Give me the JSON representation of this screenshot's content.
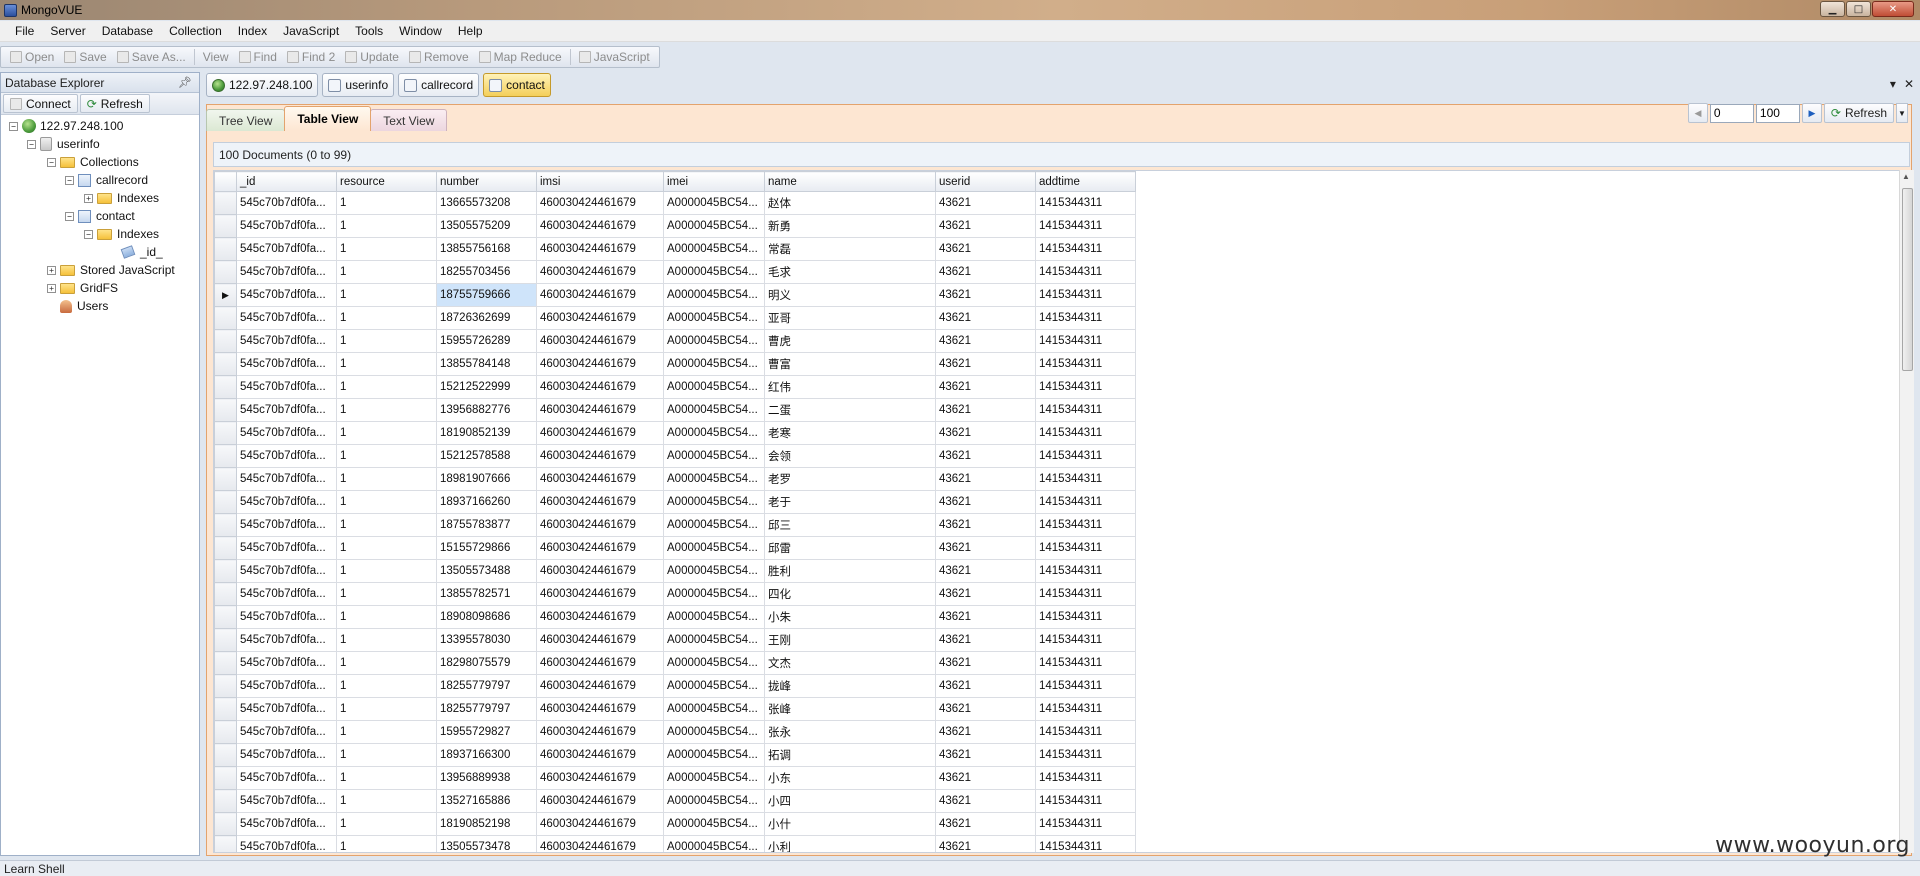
{
  "window": {
    "title": "MongoVUE"
  },
  "menu": [
    "File",
    "Server",
    "Database",
    "Collection",
    "Index",
    "JavaScript",
    "Tools",
    "Window",
    "Help"
  ],
  "toolbar": [
    {
      "label": "Open",
      "icon": "open-icon"
    },
    {
      "label": "Save",
      "icon": "save-icon"
    },
    {
      "label": "Save As...",
      "icon": "save-as-icon"
    },
    {
      "label": "View",
      "icon": ""
    },
    {
      "label": "Find",
      "icon": "find-icon"
    },
    {
      "label": "Find 2",
      "icon": "find2-icon"
    },
    {
      "label": "Update",
      "icon": "update-icon"
    },
    {
      "label": "Remove",
      "icon": "remove-icon"
    },
    {
      "label": "Map Reduce",
      "icon": "map-reduce-icon"
    },
    {
      "label": "JavaScript",
      "icon": "javascript-icon"
    }
  ],
  "explorer": {
    "title": "Database Explorer",
    "connect_label": "Connect",
    "refresh_label": "Refresh",
    "tree": {
      "server": "122.97.248.100",
      "database": "userinfo",
      "collections": "Collections",
      "callrecord": "callrecord",
      "indexes1": "Indexes",
      "contact": "contact",
      "indexes2": "Indexes",
      "index_id": "_id_",
      "stored_js": "Stored JavaScript",
      "gridfs": "GridFS",
      "users": "Users"
    }
  },
  "doc_tabs": {
    "server": "122.97.248.100",
    "db": "userinfo",
    "coll1": "callrecord",
    "coll2": "contact"
  },
  "view_tabs": {
    "tree": "Tree View",
    "table": "Table View",
    "text": "Text View"
  },
  "paging": {
    "skip": "0",
    "limit": "100",
    "refresh": "Refresh"
  },
  "summary": "100 Documents (0 to 99)",
  "table": {
    "columns": [
      "_id",
      "resource",
      "number",
      "imsi",
      "imei",
      "name",
      "userid",
      "addtime"
    ],
    "rows": [
      [
        "545c70b7df0fa...",
        "1",
        "13665573208",
        "460030424461679",
        "A0000045BC54...",
        "赵体",
        "43621",
        "1415344311"
      ],
      [
        "545c70b7df0fa...",
        "1",
        "13505575209",
        "460030424461679",
        "A0000045BC54...",
        "新勇",
        "43621",
        "1415344311"
      ],
      [
        "545c70b7df0fa...",
        "1",
        "13855756168",
        "460030424461679",
        "A0000045BC54...",
        "常磊",
        "43621",
        "1415344311"
      ],
      [
        "545c70b7df0fa...",
        "1",
        "18255703456",
        "460030424461679",
        "A0000045BC54...",
        "毛求",
        "43621",
        "1415344311"
      ],
      [
        "545c70b7df0fa...",
        "1",
        "18755759666",
        "460030424461679",
        "A0000045BC54...",
        "明义",
        "43621",
        "1415344311"
      ],
      [
        "545c70b7df0fa...",
        "1",
        "18726362699",
        "460030424461679",
        "A0000045BC54...",
        "亚哥",
        "43621",
        "1415344311"
      ],
      [
        "545c70b7df0fa...",
        "1",
        "15955726289",
        "460030424461679",
        "A0000045BC54...",
        "曹虎",
        "43621",
        "1415344311"
      ],
      [
        "545c70b7df0fa...",
        "1",
        "13855784148",
        "460030424461679",
        "A0000045BC54...",
        "曹富",
        "43621",
        "1415344311"
      ],
      [
        "545c70b7df0fa...",
        "1",
        "15212522999",
        "460030424461679",
        "A0000045BC54...",
        "红伟",
        "43621",
        "1415344311"
      ],
      [
        "545c70b7df0fa...",
        "1",
        "13956882776",
        "460030424461679",
        "A0000045BC54...",
        "二蛋",
        "43621",
        "1415344311"
      ],
      [
        "545c70b7df0fa...",
        "1",
        "18190852139",
        "460030424461679",
        "A0000045BC54...",
        "老寒",
        "43621",
        "1415344311"
      ],
      [
        "545c70b7df0fa...",
        "1",
        "15212578588",
        "460030424461679",
        "A0000045BC54...",
        "会领",
        "43621",
        "1415344311"
      ],
      [
        "545c70b7df0fa...",
        "1",
        "18981907666",
        "460030424461679",
        "A0000045BC54...",
        "老罗",
        "43621",
        "1415344311"
      ],
      [
        "545c70b7df0fa...",
        "1",
        "18937166260",
        "460030424461679",
        "A0000045BC54...",
        "老于",
        "43621",
        "1415344311"
      ],
      [
        "545c70b7df0fa...",
        "1",
        "18755783877",
        "460030424461679",
        "A0000045BC54...",
        "邱三",
        "43621",
        "1415344311"
      ],
      [
        "545c70b7df0fa...",
        "1",
        "15155729866",
        "460030424461679",
        "A0000045BC54...",
        "邱雷",
        "43621",
        "1415344311"
      ],
      [
        "545c70b7df0fa...",
        "1",
        "13505573488",
        "460030424461679",
        "A0000045BC54...",
        "胜利",
        "43621",
        "1415344311"
      ],
      [
        "545c70b7df0fa...",
        "1",
        "13855782571",
        "460030424461679",
        "A0000045BC54...",
        "四化",
        "43621",
        "1415344311"
      ],
      [
        "545c70b7df0fa...",
        "1",
        "18908098686",
        "460030424461679",
        "A0000045BC54...",
        "小朱",
        "43621",
        "1415344311"
      ],
      [
        "545c70b7df0fa...",
        "1",
        "13395578030",
        "460030424461679",
        "A0000045BC54...",
        "王刚",
        "43621",
        "1415344311"
      ],
      [
        "545c70b7df0fa...",
        "1",
        "18298075579",
        "460030424461679",
        "A0000045BC54...",
        "文杰",
        "43621",
        "1415344311"
      ],
      [
        "545c70b7df0fa...",
        "1",
        "18255779797",
        "460030424461679",
        "A0000045BC54...",
        "拢峰",
        "43621",
        "1415344311"
      ],
      [
        "545c70b7df0fa...",
        "1",
        "18255779797",
        "460030424461679",
        "A0000045BC54...",
        "张峰",
        "43621",
        "1415344311"
      ],
      [
        "545c70b7df0fa...",
        "1",
        "15955729827",
        "460030424461679",
        "A0000045BC54...",
        "张永",
        "43621",
        "1415344311"
      ],
      [
        "545c70b7df0fa...",
        "1",
        "18937166300",
        "460030424461679",
        "A0000045BC54...",
        "拓调",
        "43621",
        "1415344311"
      ],
      [
        "545c70b7df0fa...",
        "1",
        "13956889938",
        "460030424461679",
        "A0000045BC54...",
        "小东",
        "43621",
        "1415344311"
      ],
      [
        "545c70b7df0fa...",
        "1",
        "13527165886",
        "460030424461679",
        "A0000045BC54...",
        "小四",
        "43621",
        "1415344311"
      ],
      [
        "545c70b7df0fa...",
        "1",
        "18190852198",
        "460030424461679",
        "A0000045BC54...",
        "小什",
        "43621",
        "1415344311"
      ],
      [
        "545c70b7df0fa...",
        "1",
        "13505573478",
        "460030424461679",
        "A0000045BC54...",
        "小利",
        "43621",
        "1415344311"
      ]
    ],
    "selected_row": 4,
    "selected_col": 2
  },
  "statusbar": "Learn Shell",
  "watermark": "www.wooyun.org"
}
